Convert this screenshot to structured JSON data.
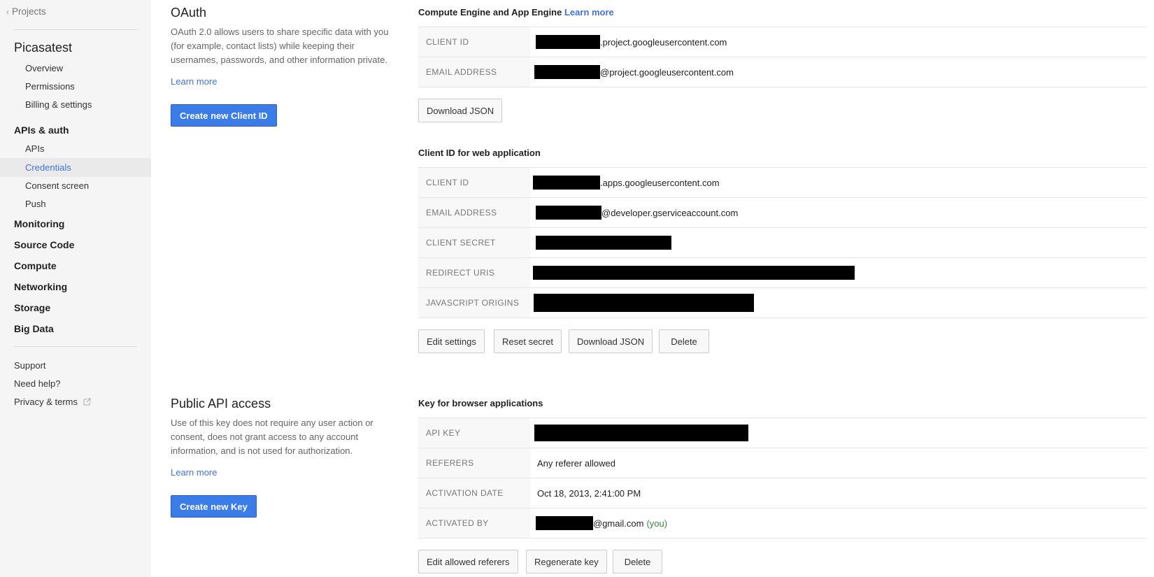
{
  "sidebar": {
    "back_label": "Projects",
    "project_name": "Picasatest",
    "project_items": [
      "Overview",
      "Permissions",
      "Billing & settings"
    ],
    "apis_section": "APIs & auth",
    "apis_items": [
      "APIs",
      "Credentials",
      "Consent screen",
      "Push"
    ],
    "sections": [
      "Monitoring",
      "Source Code",
      "Compute",
      "Networking",
      "Storage",
      "Big Data"
    ],
    "footer": [
      "Support",
      "Need help?",
      "Privacy & terms"
    ],
    "active_item": "Credentials"
  },
  "oauth": {
    "title": "OAuth",
    "description": "OAuth 2.0 allows users to share specific data with you (for example, contact lists) while keeping their usernames, passwords, and other information private.",
    "learn_more": "Learn more",
    "create_button": "Create new Client ID"
  },
  "public_api": {
    "title": "Public API access",
    "description": "Use of this key does not require any user action or consent, does not grant access to any account information, and is not used for authorization.",
    "learn_more": "Learn more",
    "create_button": "Create new Key"
  },
  "compute_engine": {
    "title": "Compute Engine and App Engine",
    "title_link": "Learn more",
    "rows": [
      {
        "key": "CLIENT ID",
        "suffix": ".project.googleusercontent.com"
      },
      {
        "key": "EMAIL ADDRESS",
        "suffix": "@project.googleusercontent.com"
      }
    ],
    "download_button": "Download JSON"
  },
  "web_app": {
    "title": "Client ID for web application",
    "rows": [
      {
        "key": "CLIENT ID",
        "suffix": ".apps.googleusercontent.com"
      },
      {
        "key": "EMAIL ADDRESS",
        "suffix": "@developer.gserviceaccount.com"
      },
      {
        "key": "CLIENT SECRET",
        "suffix": ""
      },
      {
        "key": "REDIRECT URIS",
        "suffix": ""
      },
      {
        "key": "JAVASCRIPT ORIGINS",
        "suffix": ""
      }
    ],
    "buttons": [
      "Edit settings",
      "Reset secret",
      "Download JSON",
      "Delete"
    ]
  },
  "browser_key": {
    "title": "Key for browser applications",
    "rows": [
      {
        "key": "API KEY",
        "value": ""
      },
      {
        "key": "REFERERS",
        "value": "Any referer allowed"
      },
      {
        "key": "ACTIVATION DATE",
        "value": "Oct 18, 2013, 2:41:00 PM"
      },
      {
        "key": "ACTIVATED BY",
        "value": "@gmail.com",
        "note": "(you)"
      }
    ],
    "buttons": [
      "Edit allowed referers",
      "Regenerate key",
      "Delete"
    ]
  },
  "colors": {
    "link": "#4272db",
    "primary_button": "#3a7de8",
    "sidebar_bg": "#f5f5f5",
    "you_note": "#3a8a3a"
  }
}
